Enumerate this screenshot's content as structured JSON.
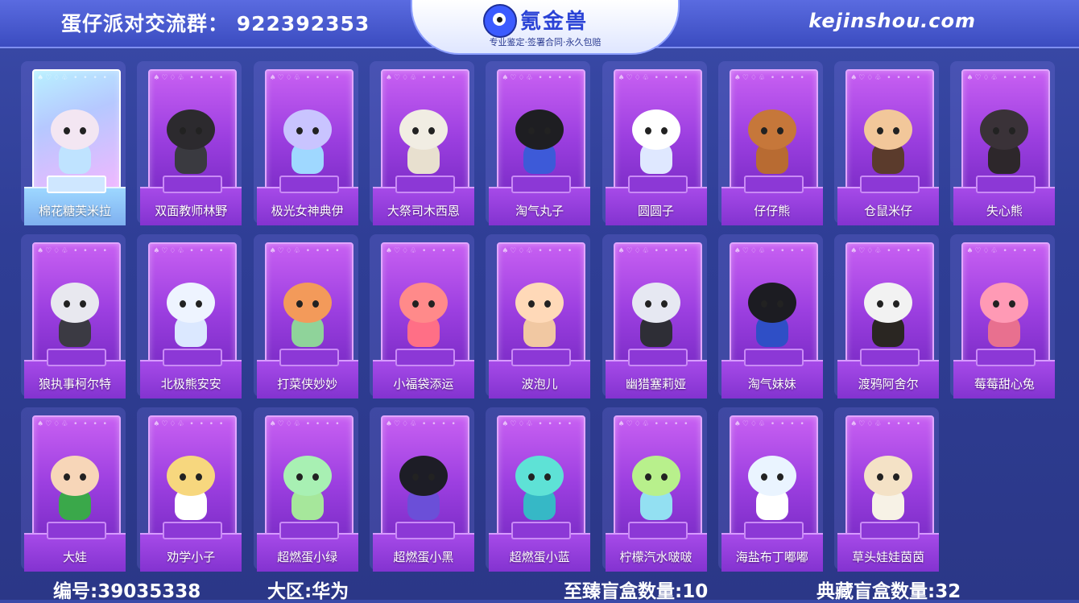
{
  "header": {
    "group_label": "蛋仔派对交流群：",
    "group_number": "922392353",
    "brand_name": "氪金兽",
    "brand_slogan": "专业鉴定·签署合同·永久包赔",
    "site": "kejinshou.com"
  },
  "items": [
    {
      "name": "棉花糖芙米拉",
      "head": "#f3e6f2",
      "body": "#bfe3ff"
    },
    {
      "name": "双面教师林野",
      "head": "#2c2a2e",
      "body": "#3a3a40"
    },
    {
      "name": "极光女神典伊",
      "head": "#c9c4ff",
      "body": "#9fd8ff"
    },
    {
      "name": "大祭司木西恩",
      "head": "#f1ede3",
      "body": "#e8e0cf"
    },
    {
      "name": "淘气丸子",
      "head": "#1e1e22",
      "body": "#3d5ad8"
    },
    {
      "name": "圆圆子",
      "head": "#ffffff",
      "body": "#dfe8ff"
    },
    {
      "name": "仔仔熊",
      "head": "#c6773a",
      "body": "#b86b32"
    },
    {
      "name": "仓鼠米仔",
      "head": "#f2c79a",
      "body": "#5b3b2c"
    },
    {
      "name": "失心熊",
      "head": "#3a3238",
      "body": "#2d272b"
    },
    {
      "name": "狼执事柯尔特",
      "head": "#e8e8ef",
      "body": "#3b3a43"
    },
    {
      "name": "北极熊安安",
      "head": "#eef4ff",
      "body": "#dbe8ff"
    },
    {
      "name": "打菜侠妙妙",
      "head": "#f39a5a",
      "body": "#8fd39a"
    },
    {
      "name": "小福袋添运",
      "head": "#ff8a8a",
      "body": "#ff6f86"
    },
    {
      "name": "波泡儿",
      "head": "#ffd9b8",
      "body": "#f1c8a2"
    },
    {
      "name": "幽猎塞莉娅",
      "head": "#e6e8f2",
      "body": "#2e2e36"
    },
    {
      "name": "淘气妹妹",
      "head": "#1c1c22",
      "body": "#2f4fc6"
    },
    {
      "name": "渡鸦阿舍尔",
      "head": "#f2f2f2",
      "body": "#2a2622"
    },
    {
      "name": "莓莓甜心兔",
      "head": "#ff9ab5",
      "body": "#e8708f"
    },
    {
      "name": "大娃",
      "head": "#f7d6b8",
      "body": "#3aa84a"
    },
    {
      "name": "劝学小子",
      "head": "#f7d77e",
      "body": "#ffffff"
    },
    {
      "name": "超燃蛋小绿",
      "head": "#a8f0b3",
      "body": "#a6e79b"
    },
    {
      "name": "超燃蛋小黑",
      "head": "#1d1d26",
      "body": "#6b4fd8"
    },
    {
      "name": "超燃蛋小蓝",
      "head": "#5ee2d6",
      "body": "#36b8c6"
    },
    {
      "name": "柠檬汽水啵啵",
      "head": "#b8f08c",
      "body": "#93e0f2"
    },
    {
      "name": "海盐布丁嘟嘟",
      "head": "#eaf4ff",
      "body": "#ffffff"
    },
    {
      "name": "草头娃娃茵茵",
      "head": "#f4e2c6",
      "body": "#f7f2e6"
    }
  ],
  "suits": "♠♡♢♧ • • • •",
  "footer": {
    "id_text": "编号:39035338",
    "region_text": "大区:华为",
    "supreme_text": "至臻盲盒数量:10",
    "collection_text": "典藏盲盒数量:32"
  }
}
